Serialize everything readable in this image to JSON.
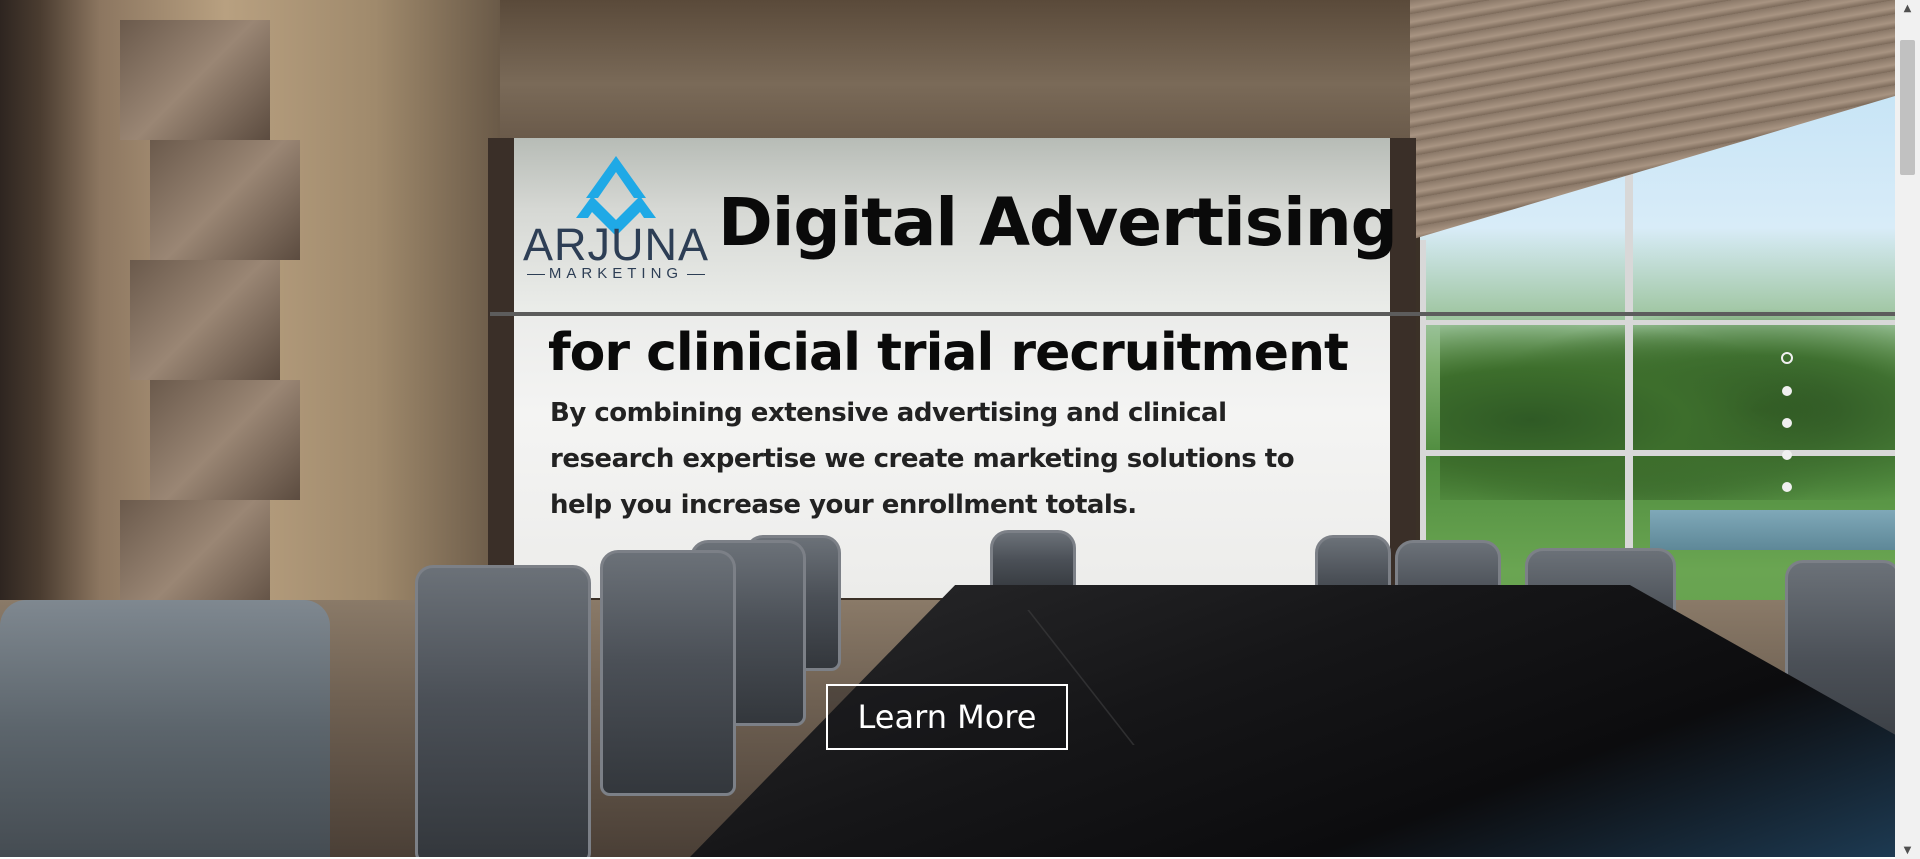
{
  "brand": {
    "name": "ARJUNA",
    "tagline": "MARKETING",
    "colors": {
      "mark": "#1fa9e6",
      "wordmark": "#2d3e55"
    }
  },
  "hero": {
    "headline": "Digital Advertising",
    "subheadline": "for clinicial trial recruitment",
    "body": "By combining extensive advertising and clinical research expertise we create marketing solutions to help you increase your enrollment totals.",
    "cta_label": "Learn More",
    "background": "conference-room-photo"
  },
  "slider": {
    "dots": [
      {
        "label": "slide-1",
        "active": false
      },
      {
        "label": "slide-2",
        "active": true
      },
      {
        "label": "slide-3",
        "active": true
      },
      {
        "label": "slide-4",
        "active": true
      },
      {
        "label": "slide-5",
        "active": true
      }
    ]
  },
  "scrollbar": {
    "up_icon": "chevron-up-icon",
    "down_icon": "chevron-down-icon"
  }
}
